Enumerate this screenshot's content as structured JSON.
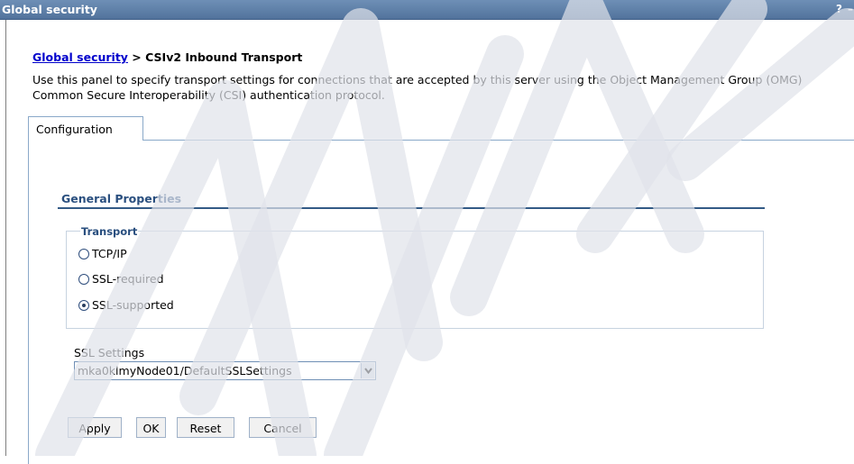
{
  "titlebar": {
    "title": "Global security",
    "help": "?",
    "minimize": "–"
  },
  "breadcrumb": {
    "link": "Global security",
    "separator": " > ",
    "current": "CSIv2 Inbound Transport"
  },
  "description": "Use this panel to specify transport settings for connections that are accepted by this server using the Object Management Group (OMG) Common Secure Interoperability (CSI) authentication protocol.",
  "tabs": [
    {
      "label": "Configuration"
    }
  ],
  "general_properties": {
    "title": "General Properties"
  },
  "transport": {
    "legend": "Transport",
    "options": [
      {
        "label": "TCP/IP",
        "selected": false
      },
      {
        "label": "SSL-required",
        "selected": false
      },
      {
        "label": "SSL-supported",
        "selected": true
      }
    ]
  },
  "ssl_settings": {
    "label": "SSL Settings",
    "selected_value": "mka0klmyNode01/DefaultSSLSettings"
  },
  "buttons": {
    "apply": "Apply",
    "ok": "OK",
    "reset": "Reset",
    "cancel": "Cancel"
  },
  "colors": {
    "titlebar": "#5f80a8",
    "link": "#0000cc",
    "section_title": "#2a4f7f",
    "tab_border": "#8aa9c9"
  }
}
